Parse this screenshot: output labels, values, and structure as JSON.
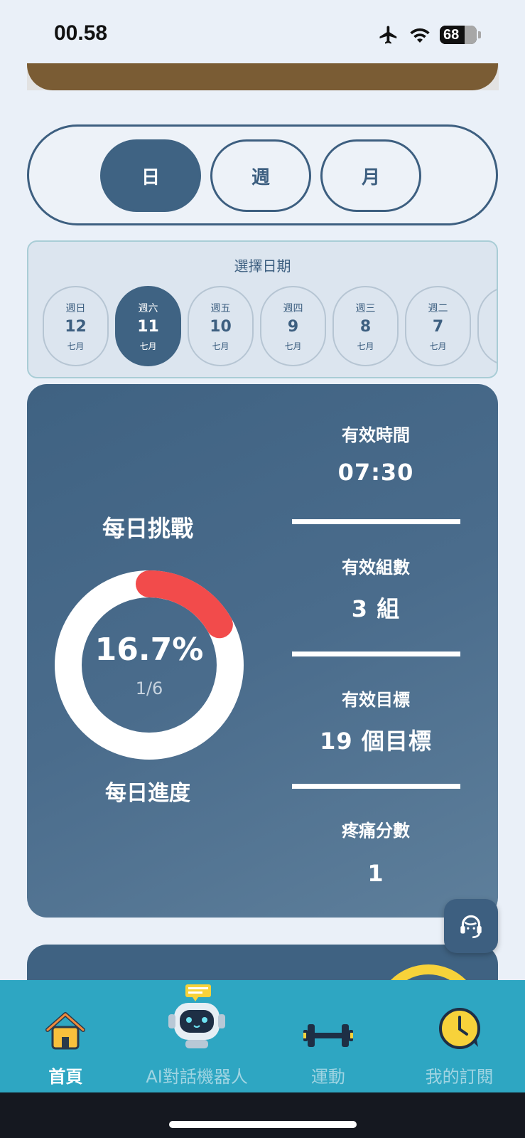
{
  "status_bar": {
    "time": "00.58",
    "battery": "68",
    "battery_level": 0.68
  },
  "segmented": {
    "day": "日",
    "week": "週",
    "month": "月",
    "selected": "day"
  },
  "date_picker": {
    "title": "選擇日期",
    "days": [
      {
        "weekday": "週日",
        "date": "12",
        "month": "七月"
      },
      {
        "weekday": "週六",
        "date": "11",
        "month": "七月",
        "selected": true
      },
      {
        "weekday": "週五",
        "date": "10",
        "month": "七月"
      },
      {
        "weekday": "週四",
        "date": "9",
        "month": "七月"
      },
      {
        "weekday": "週三",
        "date": "8",
        "month": "七月"
      },
      {
        "weekday": "週二",
        "date": "7",
        "month": "七月"
      }
    ]
  },
  "daily_card": {
    "title": "每日挑戰",
    "percent": "16.7%",
    "fraction": "1/6",
    "progress_value": 0.167,
    "progress_label": "每日進度",
    "accent": "#F24B4B",
    "stats": [
      {
        "label": "有效時間",
        "value": "07:30"
      },
      {
        "label": "有效組數",
        "value": "3 組"
      },
      {
        "label": "有效目標",
        "value": "19 個目標"
      },
      {
        "label": "疼痛分數",
        "value": "1"
      }
    ]
  },
  "support_button": {
    "icon": "headset-icon"
  },
  "tabbar": {
    "items": [
      {
        "label": "首頁",
        "icon": "home-icon",
        "active": true
      },
      {
        "label": "AI對話機器人",
        "icon": "robot-icon"
      },
      {
        "label": "運動",
        "icon": "dumbbell-icon"
      },
      {
        "label": "我的訂閱",
        "icon": "clock-icon"
      }
    ],
    "background": "#2EA6C2"
  }
}
